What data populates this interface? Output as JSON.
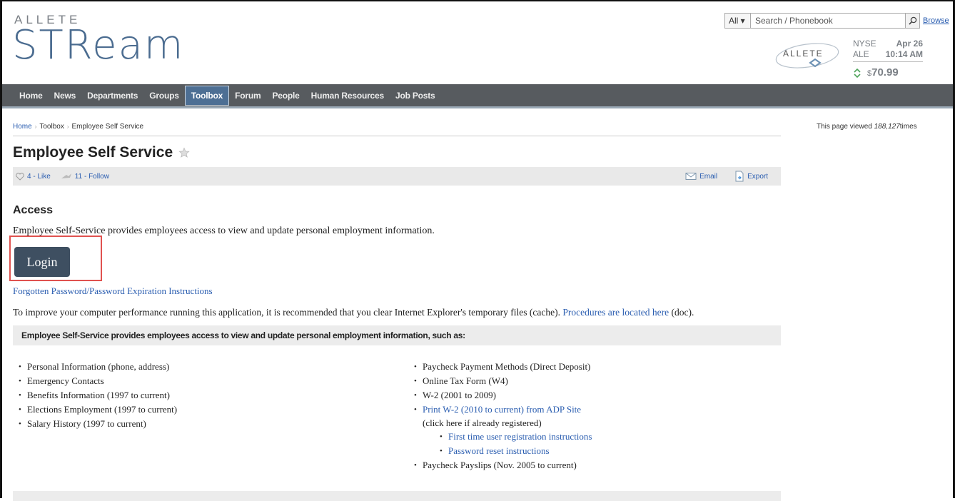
{
  "brand": {
    "top": "ALLETE",
    "main": "STReam"
  },
  "search": {
    "scope": "All ▾",
    "placeholder": "Search / Phonebook",
    "browse": "Browse"
  },
  "stock": {
    "logo_text": "ALLETE",
    "exchange": "NYSE",
    "date": "Apr 26",
    "ticker": "ALE",
    "time": "10:14 AM",
    "currency": "$",
    "price": "70.99"
  },
  "nav": {
    "items": [
      "Home",
      "News",
      "Departments",
      "Groups",
      "Toolbox",
      "Forum",
      "People",
      "Human Resources",
      "Job Posts"
    ],
    "active": "Toolbox"
  },
  "breadcrumb": {
    "home": "Home",
    "toolbox": "Toolbox",
    "current": "Employee Self Service"
  },
  "views": {
    "prefix": "This page viewed ",
    "count": "188,127",
    "suffix": "times"
  },
  "page": {
    "title": "Employee Self Service"
  },
  "toolbar": {
    "like": "4 - Like",
    "follow": "11 - Follow",
    "email": "Email",
    "export": "Export"
  },
  "access": {
    "heading": "Access",
    "intro": "Employee Self-Service provides employees access to view and update personal employment information.",
    "login": "Login",
    "forgot": "Forgotten Password/Password Expiration Instructions",
    "perf_text": "To improve your computer performance running this application, it is recommended that you clear Internet Explorer's temporary files (cache). ",
    "perf_link": "Procedures are located here",
    "perf_suffix": " (doc)."
  },
  "info": {
    "heading": "Employee Self-Service provides employees access to view and update personal employment information, such as:",
    "left": [
      "Personal Information (phone, address)",
      "Emergency Contacts",
      "Benefits Information (1997 to current)",
      "Elections Employment (1997 to current)",
      "Salary History (1997 to current)"
    ],
    "right": {
      "item1": "Paycheck Payment Methods (Direct Deposit)",
      "item2": "Online Tax Form (W4)",
      "item3": "W-2 (2001 to 2009)",
      "item4_link": "Print W-2 (2010 to current) from ADP Site",
      "item4_note": "(click here if already registered)",
      "sub1": "First time user registration instructions",
      "sub2": "Password reset instructions",
      "item5": "Paycheck Payslips (Nov. 2005 to current)"
    }
  },
  "colors": {
    "nav_bg": "#575b5f",
    "nav_active": "#4d6f94",
    "login_bg": "#3e4f61",
    "highlight": "#e0524f",
    "link": "#2a5db0"
  }
}
